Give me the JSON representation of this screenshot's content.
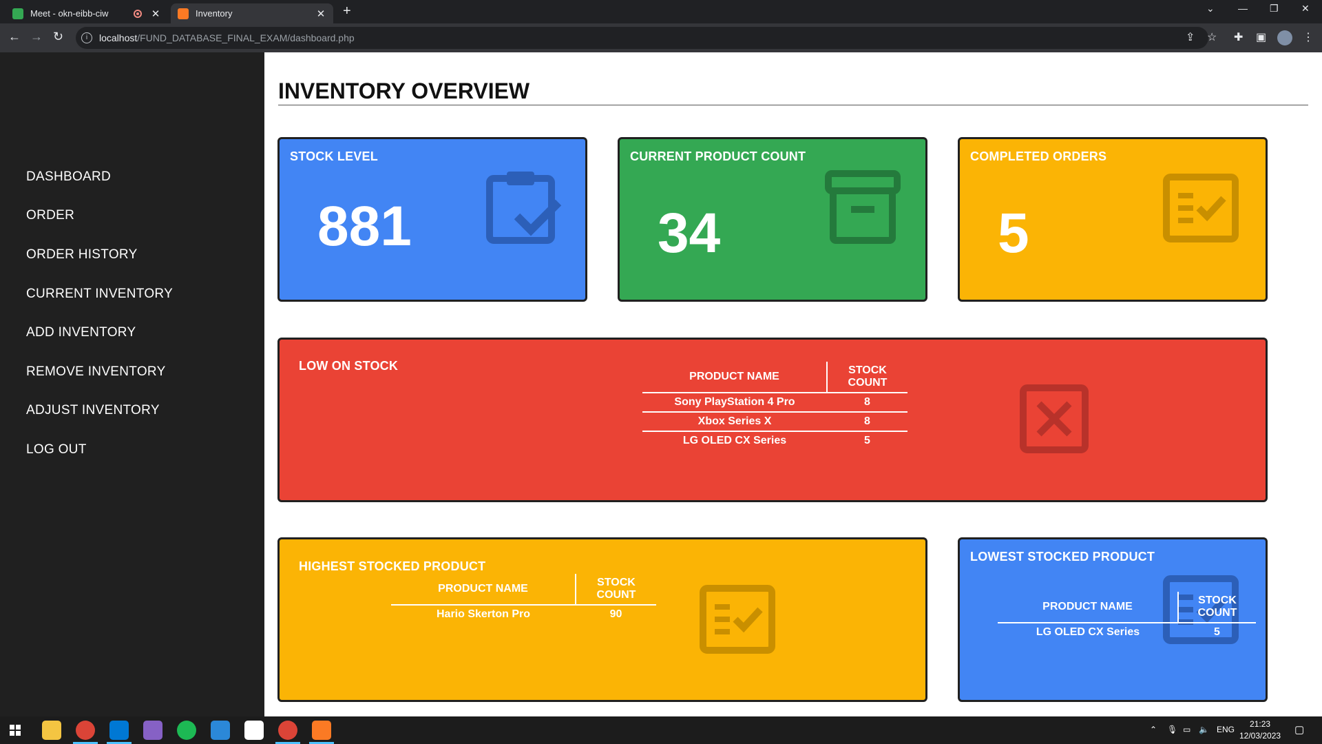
{
  "browser": {
    "tabs": [
      {
        "label": "Meet - okn-eibb-ciw",
        "active": false
      },
      {
        "label": "Inventory",
        "active": true
      }
    ],
    "url_host": "localhost",
    "url_path": "/FUND_DATABASE_FINAL_EXAM/dashboard.php"
  },
  "sidebar": {
    "items": [
      {
        "label": "DASHBOARD"
      },
      {
        "label": "ORDER"
      },
      {
        "label": "ORDER HISTORY"
      },
      {
        "label": "CURRENT INVENTORY"
      },
      {
        "label": "ADD INVENTORY"
      },
      {
        "label": "REMOVE INVENTORY"
      },
      {
        "label": "ADJUST INVENTORY"
      },
      {
        "label": "LOG OUT"
      }
    ]
  },
  "main": {
    "title": "INVENTORY OVERVIEW",
    "cards": {
      "stock_level": {
        "title": "STOCK LEVEL",
        "value": "881",
        "color": "#4285f4",
        "icon": "clipboard-check-icon"
      },
      "product_count": {
        "title": "CURRENT PRODUCT COUNT",
        "value": "34",
        "color": "#34a853",
        "icon": "archive-box-icon"
      },
      "completed_orders": {
        "title": "COMPLETED ORDERS",
        "value": "5",
        "color": "#fbb405",
        "icon": "checklist-icon"
      }
    },
    "low_stock": {
      "title": "LOW ON STOCK",
      "color": "#ea4335",
      "icon": "close-box-icon",
      "headers": [
        "PRODUCT NAME",
        "STOCK COUNT"
      ],
      "rows": [
        {
          "name": "Sony PlayStation 4 Pro",
          "count": "8"
        },
        {
          "name": "Xbox Series X",
          "count": "8"
        },
        {
          "name": "LG OLED CX Series",
          "count": "5"
        }
      ]
    },
    "highest": {
      "title": "HIGHEST STOCKED PRODUCT",
      "color": "#fbb405",
      "icon": "checklist-icon",
      "headers": [
        "PRODUCT NAME",
        "STOCK COUNT"
      ],
      "rows": [
        {
          "name": "Hario Skerton Pro",
          "count": "90"
        }
      ]
    },
    "lowest": {
      "title": "LOWEST STOCKED PRODUCT",
      "color": "#4285f4",
      "icon": "checklist-icon",
      "headers": [
        "PRODUCT NAME",
        "STOCK COUNT"
      ],
      "rows": [
        {
          "name": "LG OLED CX Series",
          "count": "5"
        }
      ]
    }
  },
  "taskbar": {
    "language": "ENG",
    "time": "21:23",
    "date": "12/03/2023"
  }
}
